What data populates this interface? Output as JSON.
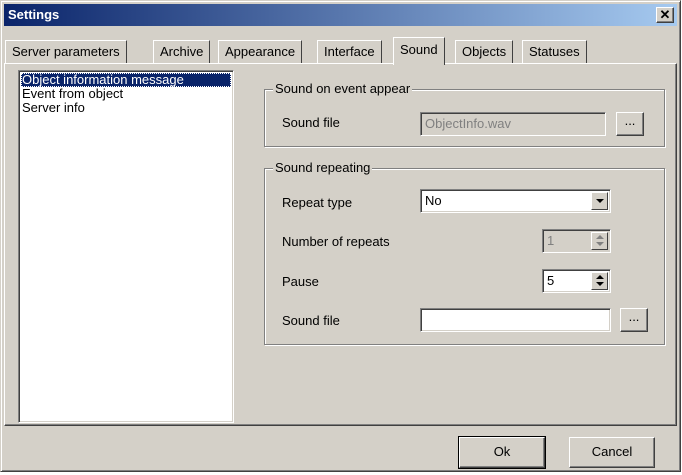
{
  "window": {
    "title": "Settings",
    "close_glyph": "✕"
  },
  "tabs": [
    {
      "label": "Server parameters"
    },
    {
      "label": "Archive"
    },
    {
      "label": "Appearance"
    },
    {
      "label": "Interface"
    },
    {
      "label": "Sound",
      "active": true
    },
    {
      "label": "Objects"
    },
    {
      "label": "Statuses"
    }
  ],
  "event_list": {
    "items": [
      {
        "label": "Object information message",
        "selected": true
      },
      {
        "label": "Event from object"
      },
      {
        "label": "Server info"
      }
    ]
  },
  "sound_on_event": {
    "title": "Sound on event appear",
    "sound_file_label": "Sound file",
    "sound_file_value": "ObjectInfo.wav",
    "browse_label": "..."
  },
  "sound_repeating": {
    "title": "Sound repeating",
    "repeat_type_label": "Repeat type",
    "repeat_type_value": "No",
    "repeats_label": "Number of repeats",
    "repeats_value": "1",
    "pause_label": "Pause",
    "pause_value": "5",
    "sound_file_label": "Sound file",
    "sound_file_value": "",
    "browse_label": "..."
  },
  "buttons": {
    "ok": "Ok",
    "cancel": "Cancel"
  }
}
